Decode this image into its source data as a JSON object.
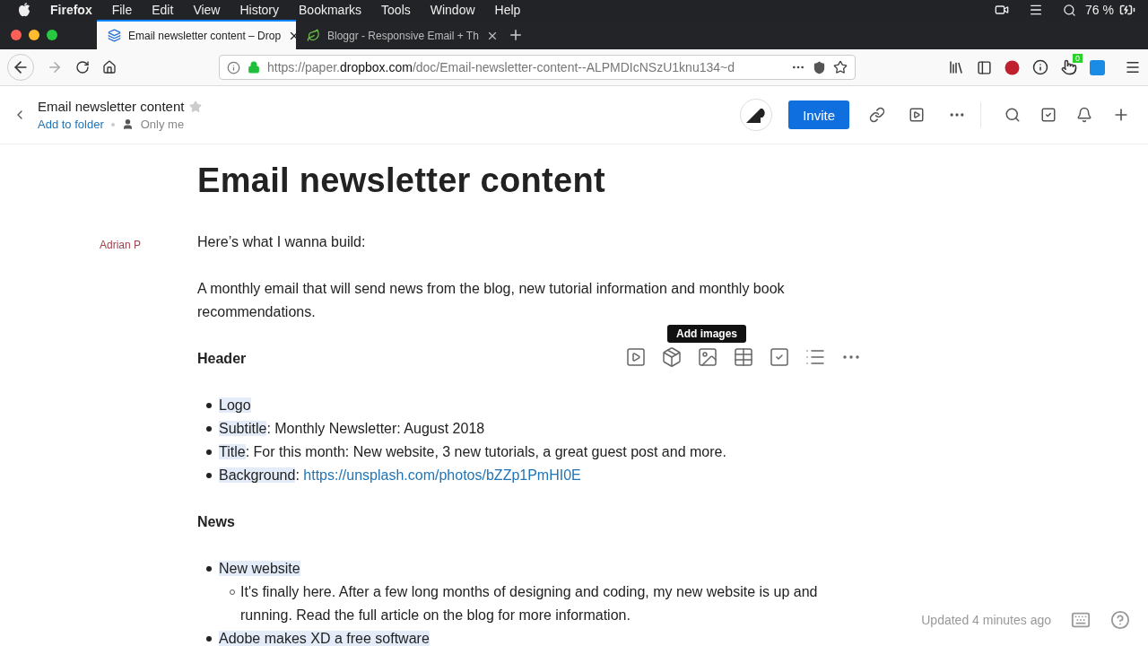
{
  "menu_bar": {
    "app": "Firefox",
    "items": [
      "File",
      "Edit",
      "View",
      "History",
      "Bookmarks",
      "Tools",
      "Window",
      "Help"
    ],
    "battery_text": "76 %"
  },
  "tabs": [
    {
      "title": "Email newsletter content – Drop",
      "selected": true,
      "kind": "paper"
    },
    {
      "title": "Bloggr - Responsive Email + Th",
      "selected": false,
      "kind": "leaf"
    }
  ],
  "address_bar": {
    "url_start": "https://paper.",
    "url_domain": "dropbox.com",
    "url_rest": "/doc/Email-newsletter-content--ALPMDIcNSzU1knu134~d"
  },
  "extension_badge": "0",
  "doc_header": {
    "title": "Email newsletter content",
    "starred": false,
    "add_to_folder": "Add to folder",
    "sharing": "Only me",
    "invite": "Invite"
  },
  "author": "Adrian P",
  "document": {
    "title": "Email newsletter content",
    "blocks": [
      {
        "kind": "paragraph",
        "text": "Here’s what I wanna build:"
      },
      {
        "kind": "paragraph",
        "text": "A monthly email that will send news from the blog, new tutorial information and monthly book recommendations."
      },
      {
        "kind": "heading",
        "text": "Header"
      },
      {
        "kind": "list",
        "items": [
          {
            "parts": [
              {
                "kind": "highlight",
                "text": "Logo"
              }
            ]
          },
          {
            "parts": [
              {
                "kind": "highlight",
                "text": "Subtitle"
              },
              {
                "kind": "plain",
                "text": ": Monthly Newsletter: August 2018"
              }
            ]
          },
          {
            "parts": [
              {
                "kind": "highlight",
                "text": "Title"
              },
              {
                "kind": "plain",
                "text": ": For this month: New website, 3 new tutorials, a great guest post and more."
              }
            ]
          },
          {
            "parts": [
              {
                "kind": "highlight",
                "text": "Background"
              },
              {
                "kind": "plain",
                "text": ": "
              },
              {
                "kind": "link",
                "text": "https://unsplash.com/photos/bZZp1PmHI0E"
              }
            ]
          }
        ]
      },
      {
        "kind": "heading",
        "text": "News"
      },
      {
        "kind": "list",
        "items": [
          {
            "parts": [
              {
                "kind": "highlight",
                "text": "New website"
              }
            ],
            "children": [
              {
                "parts": [
                  {
                    "kind": "plain",
                    "text": "It's finally here. After a few long months of designing and coding, my new website is up and running. Read the full article on the blog for more information."
                  }
                ]
              }
            ]
          },
          {
            "parts": [
              {
                "kind": "highlight",
                "text": "Adobe makes XD a free software"
              }
            ]
          }
        ]
      }
    ]
  },
  "insert_toolbar": {
    "tooltip": "Add images"
  },
  "footer": {
    "updated": "Updated 4 minutes ago"
  }
}
